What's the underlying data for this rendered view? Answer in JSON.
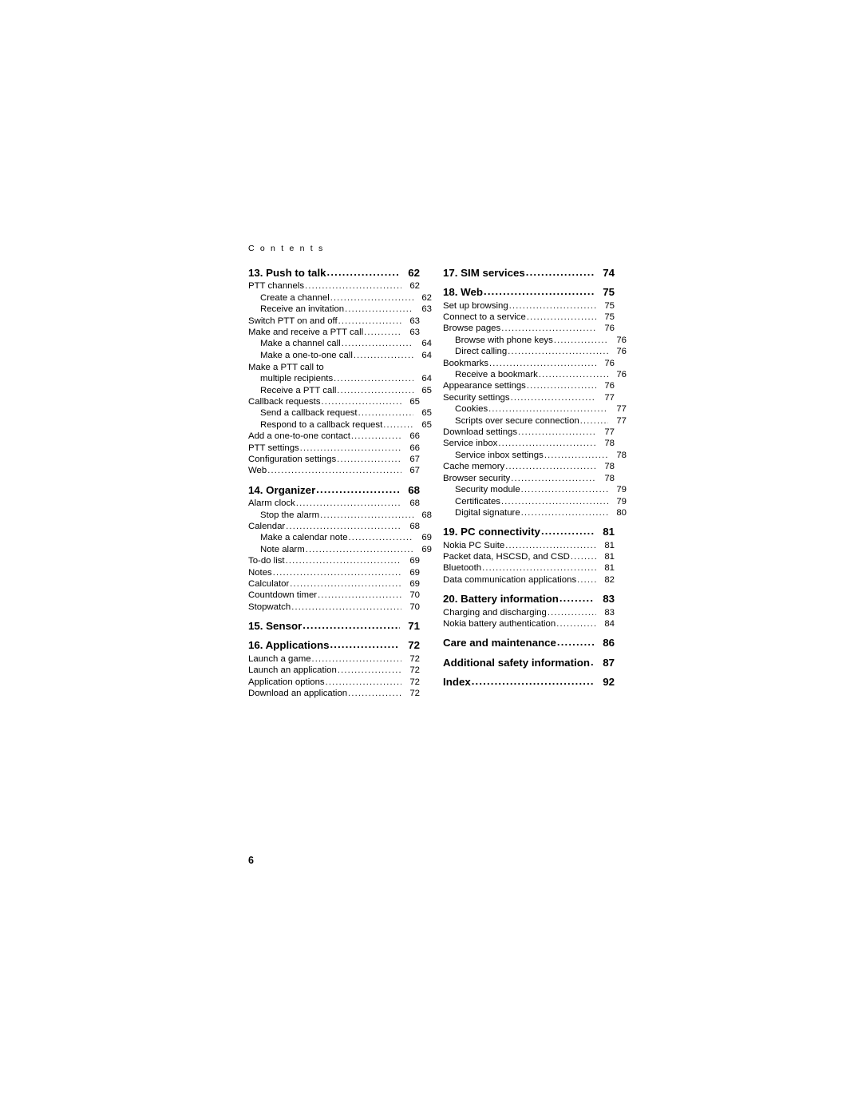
{
  "header": "C o n t e n t s",
  "page_number": "6",
  "dot_leader": "........................................................................................",
  "left_column": [
    {
      "level": "chapter",
      "text": "13. Push to talk",
      "page": "62"
    },
    {
      "level": "1",
      "text": "PTT channels",
      "page": "62"
    },
    {
      "level": "2",
      "text": "Create a channel",
      "page": "62"
    },
    {
      "level": "2",
      "text": "Receive an invitation",
      "page": "63"
    },
    {
      "level": "1",
      "text": "Switch PTT on and off",
      "page": "63"
    },
    {
      "level": "1",
      "text": "Make and receive a PTT call",
      "page": "63"
    },
    {
      "level": "2",
      "text": "Make a channel call",
      "page": "64"
    },
    {
      "level": "2",
      "text": "Make a one-to-one call",
      "page": "64"
    },
    {
      "level": "plain",
      "text": "Make a PTT call to",
      "page": ""
    },
    {
      "level": "2",
      "text": "multiple recipients",
      "page": "64"
    },
    {
      "level": "2",
      "text": "Receive a PTT call",
      "page": "65"
    },
    {
      "level": "1",
      "text": "Callback requests",
      "page": "65"
    },
    {
      "level": "2",
      "text": "Send a callback request",
      "page": "65"
    },
    {
      "level": "2",
      "text": "Respond to a callback request",
      "page": "65"
    },
    {
      "level": "1",
      "text": "Add a one-to-one contact",
      "page": "66"
    },
    {
      "level": "1",
      "text": "PTT settings",
      "page": "66"
    },
    {
      "level": "1",
      "text": "Configuration settings",
      "page": "67"
    },
    {
      "level": "1",
      "text": "Web",
      "page": "67"
    },
    {
      "level": "chapter",
      "text": "14. Organizer",
      "page": "68"
    },
    {
      "level": "1",
      "text": "Alarm clock",
      "page": "68"
    },
    {
      "level": "2",
      "text": "Stop the alarm",
      "page": "68"
    },
    {
      "level": "1",
      "text": "Calendar",
      "page": "68"
    },
    {
      "level": "2",
      "text": "Make a calendar note",
      "page": "69"
    },
    {
      "level": "2",
      "text": "Note alarm",
      "page": "69"
    },
    {
      "level": "1",
      "text": "To-do list",
      "page": "69"
    },
    {
      "level": "1",
      "text": "Notes",
      "page": "69"
    },
    {
      "level": "1",
      "text": "Calculator",
      "page": "69"
    },
    {
      "level": "1",
      "text": "Countdown timer",
      "page": "70"
    },
    {
      "level": "1",
      "text": "Stopwatch",
      "page": "70"
    },
    {
      "level": "chapter",
      "text": "15. Sensor",
      "page": "71"
    },
    {
      "level": "chapter",
      "text": "16. Applications",
      "page": "72"
    },
    {
      "level": "1",
      "text": "Launch a game",
      "page": "72"
    },
    {
      "level": "1",
      "text": "Launch an application",
      "page": "72"
    },
    {
      "level": "1",
      "text": "Application options",
      "page": "72"
    },
    {
      "level": "1",
      "text": "Download an application",
      "page": "72"
    }
  ],
  "right_column": [
    {
      "level": "chapter",
      "text": "17. SIM services",
      "page": "74"
    },
    {
      "level": "chapter",
      "text": "18. Web",
      "page": "75"
    },
    {
      "level": "1",
      "text": "Set up browsing",
      "page": "75"
    },
    {
      "level": "1",
      "text": "Connect to a service",
      "page": "75"
    },
    {
      "level": "1",
      "text": "Browse pages",
      "page": "76"
    },
    {
      "level": "2",
      "text": "Browse with phone keys",
      "page": "76"
    },
    {
      "level": "2",
      "text": "Direct calling",
      "page": "76"
    },
    {
      "level": "1",
      "text": "Bookmarks",
      "page": "76"
    },
    {
      "level": "2",
      "text": "Receive a bookmark",
      "page": "76"
    },
    {
      "level": "1",
      "text": "Appearance settings",
      "page": "76"
    },
    {
      "level": "1",
      "text": "Security settings",
      "page": "77"
    },
    {
      "level": "2",
      "text": "Cookies",
      "page": "77"
    },
    {
      "level": "2",
      "text": "Scripts over secure connection",
      "page": "77"
    },
    {
      "level": "1",
      "text": "Download settings",
      "page": "77"
    },
    {
      "level": "1",
      "text": "Service inbox",
      "page": "78"
    },
    {
      "level": "2",
      "text": "Service inbox settings",
      "page": "78"
    },
    {
      "level": "1",
      "text": "Cache memory",
      "page": "78"
    },
    {
      "level": "1",
      "text": "Browser security",
      "page": "78"
    },
    {
      "level": "2",
      "text": "Security module",
      "page": "79"
    },
    {
      "level": "2",
      "text": "Certificates",
      "page": "79"
    },
    {
      "level": "2",
      "text": "Digital signature",
      "page": "80"
    },
    {
      "level": "chapter",
      "text": "19. PC connectivity",
      "page": "81"
    },
    {
      "level": "1",
      "text": "Nokia PC Suite",
      "page": "81"
    },
    {
      "level": "1",
      "text": "Packet data, HSCSD, and CSD",
      "page": "81"
    },
    {
      "level": "1",
      "text": "Bluetooth",
      "page": "81"
    },
    {
      "level": "1",
      "text": "Data communication applications",
      "page": "82"
    },
    {
      "level": "chapter",
      "text": "20. Battery information",
      "page": "83"
    },
    {
      "level": "1",
      "text": "Charging and discharging",
      "page": "83"
    },
    {
      "level": "1",
      "text": "Nokia battery authentication",
      "page": "84"
    },
    {
      "level": "chapter",
      "text": "Care and maintenance",
      "page": "86"
    },
    {
      "level": "chapter",
      "text": "Additional safety information",
      "page": "87"
    },
    {
      "level": "chapter",
      "text": "Index",
      "page": "92"
    }
  ]
}
